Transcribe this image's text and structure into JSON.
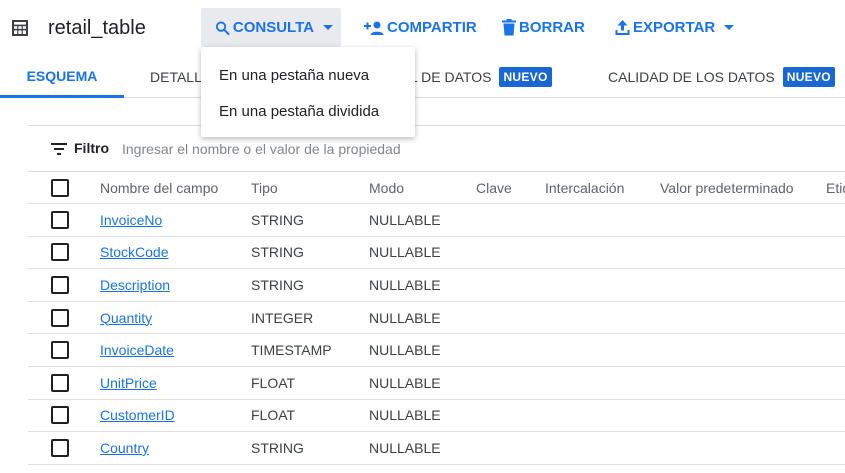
{
  "header": {
    "title": "retail_table",
    "buttons": {
      "consulta": "CONSULTA",
      "compartir": "COMPARTIR",
      "borrar": "BORRAR",
      "exportar": "EXPORTAR"
    }
  },
  "tabs": {
    "esquema": "ESQUEMA",
    "detalles": "DETALL",
    "linaje": "L DE DATOS",
    "calidad": "CALIDAD DE LOS DATOS",
    "badge": "NUEVO"
  },
  "menu": {
    "items": [
      "En una pestaña nueva",
      "En una pestaña dividida"
    ]
  },
  "filter": {
    "label": "Filtro",
    "placeholder": "Ingresar el nombre o el valor de la propiedad"
  },
  "table": {
    "columns": {
      "name": "Nombre del campo",
      "type": "Tipo",
      "mode": "Modo",
      "key": "Clave",
      "collation": "Intercalación",
      "default": "Valor predeterminado",
      "tags": "Etiq"
    },
    "rows": [
      {
        "name": "InvoiceNo",
        "type": "STRING",
        "mode": "NULLABLE"
      },
      {
        "name": "StockCode",
        "type": "STRING",
        "mode": "NULLABLE"
      },
      {
        "name": "Description",
        "type": "STRING",
        "mode": "NULLABLE"
      },
      {
        "name": "Quantity",
        "type": "INTEGER",
        "mode": "NULLABLE"
      },
      {
        "name": "InvoiceDate",
        "type": "TIMESTAMP",
        "mode": "NULLABLE"
      },
      {
        "name": "UnitPrice",
        "type": "FLOAT",
        "mode": "NULLABLE"
      },
      {
        "name": "CustomerID",
        "type": "FLOAT",
        "mode": "NULLABLE"
      },
      {
        "name": "Country",
        "type": "STRING",
        "mode": "NULLABLE"
      }
    ]
  },
  "colors": {
    "accent": "#1a73e8",
    "badge": "#1967d2",
    "button_bg": "#e8eaed"
  },
  "icons": {
    "table": "table-icon",
    "search": "search-icon",
    "share": "person-add-icon",
    "delete": "trash-icon",
    "export": "upload-icon",
    "filter": "filter-icon"
  }
}
